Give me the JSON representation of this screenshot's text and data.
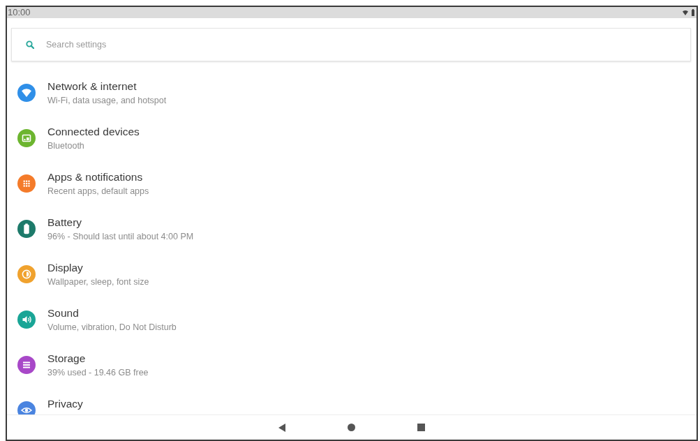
{
  "status_bar": {
    "time": "10:00"
  },
  "search": {
    "placeholder": "Search settings"
  },
  "settings": [
    {
      "title": "Network & internet",
      "subtitle": "Wi-Fi, data usage, and hotspot",
      "color": "#2f8fe8"
    },
    {
      "title": "Connected devices",
      "subtitle": "Bluetooth",
      "color": "#6cb52f"
    },
    {
      "title": "Apps & notifications",
      "subtitle": "Recent apps, default apps",
      "color": "#f47b2a"
    },
    {
      "title": "Battery",
      "subtitle": "96% - Should last until about 4:00 PM",
      "color": "#1d7a6a"
    },
    {
      "title": "Display",
      "subtitle": "Wallpaper, sleep, font size",
      "color": "#f0a22e"
    },
    {
      "title": "Sound",
      "subtitle": "Volume, vibration, Do Not Disturb",
      "color": "#19a596"
    },
    {
      "title": "Storage",
      "subtitle": "39% used - 19.46 GB free",
      "color": "#a848c8"
    },
    {
      "title": "Privacy",
      "color": "#4a84e0"
    }
  ]
}
